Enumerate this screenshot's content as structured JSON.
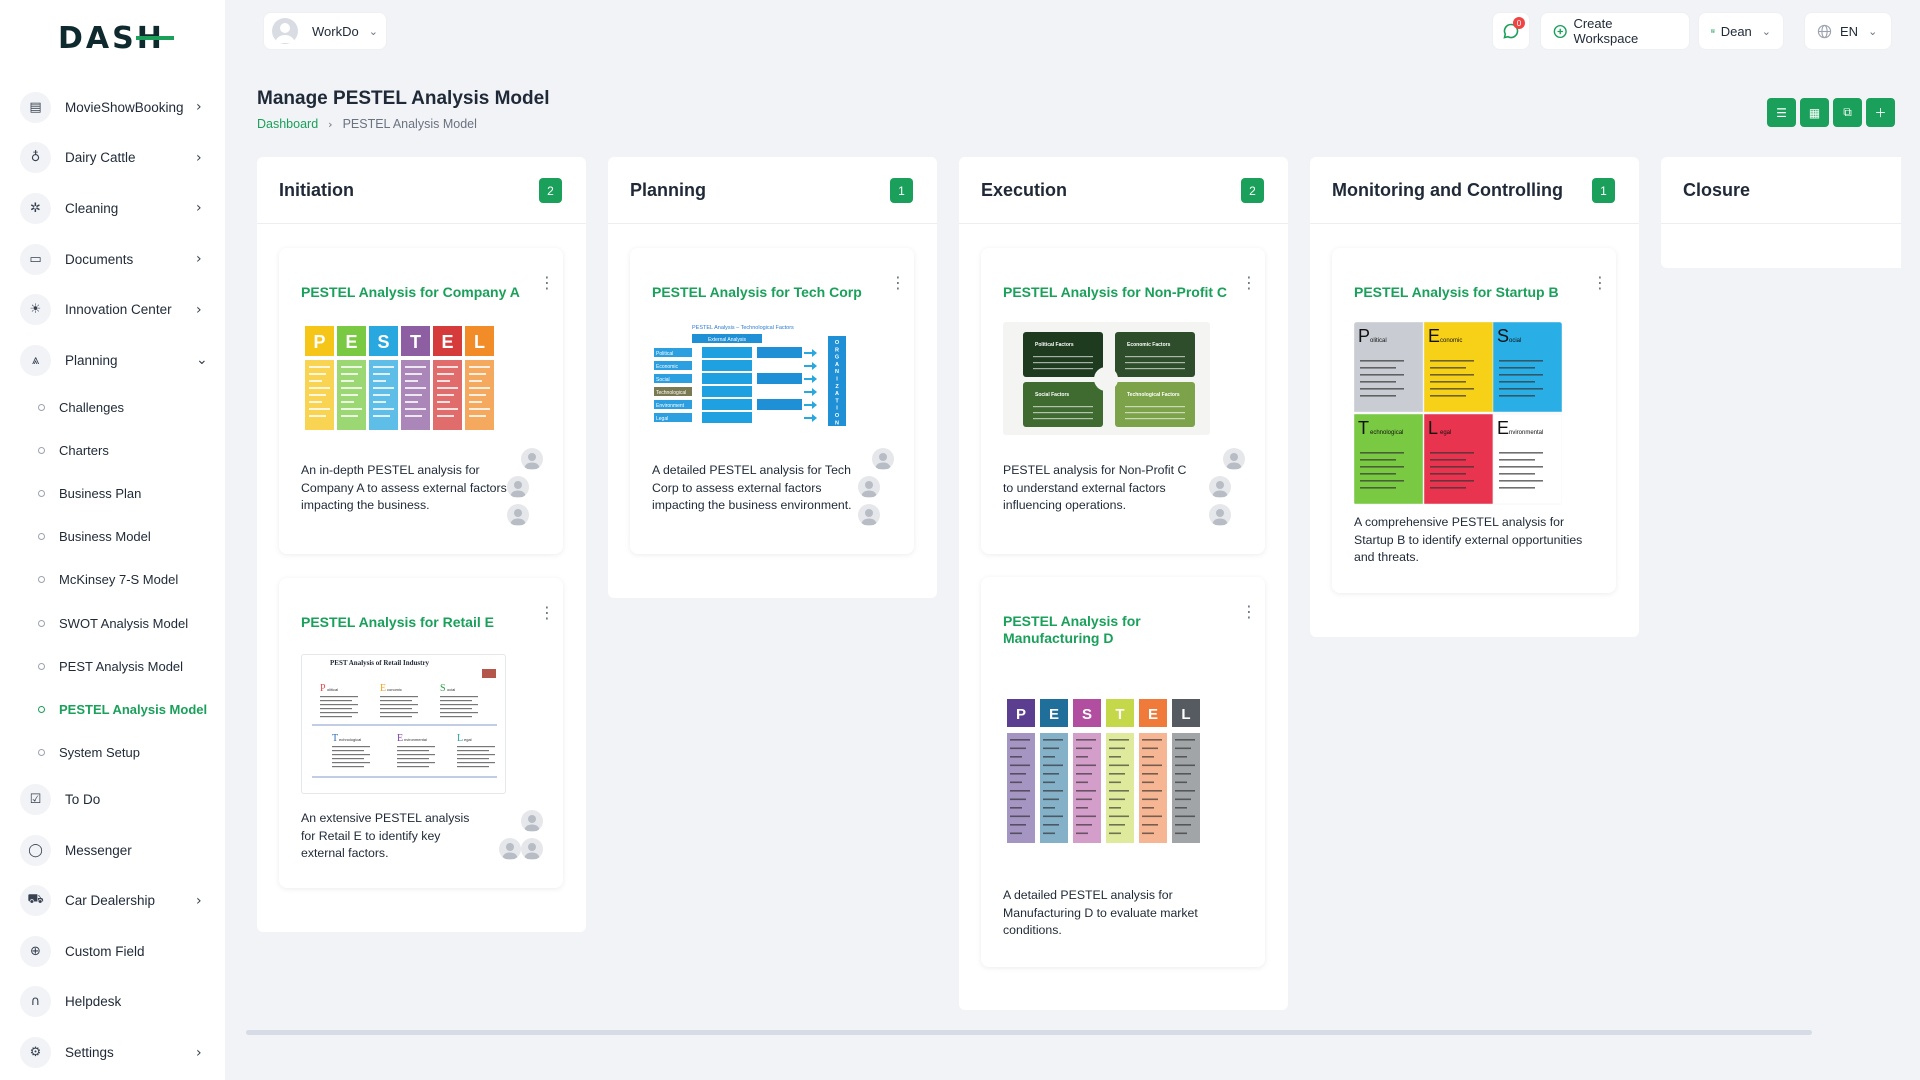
{
  "brand": {
    "logo_text": "DASH",
    "accent": "#1aa05a"
  },
  "sidebar": {
    "items": [
      {
        "label": "MovieShowBooking",
        "icon": "film-icon",
        "chevron": "›"
      },
      {
        "label": "Dairy Cattle",
        "icon": "bottle-icon",
        "chevron": "›"
      },
      {
        "label": "Cleaning",
        "icon": "sparkle-icon",
        "chevron": "›"
      },
      {
        "label": "Documents",
        "icon": "document-icon",
        "chevron": "›"
      },
      {
        "label": "Innovation Center",
        "icon": "bulb-icon",
        "chevron": "›"
      },
      {
        "label": "Planning",
        "icon": "planning-icon",
        "chevron": "⌄"
      }
    ],
    "planning_sub": [
      {
        "label": "Challenges"
      },
      {
        "label": "Charters"
      },
      {
        "label": "Business Plan"
      },
      {
        "label": "Business Model"
      },
      {
        "label": "McKinsey 7-S Model"
      },
      {
        "label": "SWOT Analysis Model"
      },
      {
        "label": "PEST Analysis Model"
      },
      {
        "label": "PESTEL Analysis Model"
      },
      {
        "label": "System Setup"
      }
    ],
    "items_after": [
      {
        "label": "To Do",
        "icon": "checklist-icon",
        "chevron": ""
      },
      {
        "label": "Messenger",
        "icon": "chat-icon",
        "chevron": ""
      },
      {
        "label": "Car Dealership",
        "icon": "car-icon",
        "chevron": "›"
      },
      {
        "label": "Custom Field",
        "icon": "plus-circle-icon",
        "chevron": ""
      },
      {
        "label": "Helpdesk",
        "icon": "headset-icon",
        "chevron": ""
      },
      {
        "label": "Settings",
        "icon": "gear-icon",
        "chevron": "›"
      }
    ]
  },
  "topbar": {
    "workspace": "WorkDo",
    "notification_count": "0",
    "create_workspace": "Create Workspace",
    "user": "Dean",
    "language": "EN"
  },
  "header": {
    "title": "Manage PESTEL Analysis Model",
    "breadcrumb": [
      "Dashboard",
      "PESTEL Analysis Model"
    ]
  },
  "board": {
    "columns": [
      {
        "title": "Initiation",
        "count": "2"
      },
      {
        "title": "Planning",
        "count": "1"
      },
      {
        "title": "Execution",
        "count": "2"
      },
      {
        "title": "Monitoring and Controlling",
        "count": "1"
      },
      {
        "title": "Closure",
        "count": ""
      }
    ],
    "cards": {
      "company_a": {
        "title": "PESTEL Analysis for Company A",
        "desc": "An in-depth PESTEL analysis for Company A to assess external factors impacting the business."
      },
      "retail_e": {
        "title": "PESTEL Analysis for Retail E",
        "desc": "An extensive PESTEL analysis for Retail E to identify key external factors."
      },
      "tech_corp": {
        "title": "PESTEL Analysis for Tech Corp",
        "desc": "A detailed PESTEL analysis for Tech Corp to assess external factors impacting the business environment."
      },
      "non_profit_c": {
        "title": "PESTEL Analysis for Non-Profit C",
        "desc": "PESTEL analysis for Non-Profit C to understand external factors influencing operations."
      },
      "manufacturing_d": {
        "title": "PESTEL Analysis for Manufacturing D",
        "desc": "A detailed PESTEL analysis for Manufacturing D to evaluate market conditions."
      },
      "startup_b": {
        "title": "PESTEL Analysis for Startup B",
        "desc": "A comprehensive PESTEL analysis for Startup B to identify external opportunities and threats."
      }
    },
    "thumb_letters": [
      "P",
      "E",
      "S",
      "T",
      "E",
      "L"
    ],
    "thumb_colors": [
      "#f5c518",
      "#7ac943",
      "#29a8e0",
      "#8e5ea2",
      "#d63b3b",
      "#f28c28"
    ],
    "tech_corp_thumb": {
      "heading": "PESTEL Analysis – Technological Factors",
      "center": "External Analysis",
      "factors": [
        "Political",
        "Economic",
        "Social",
        "Technological",
        "Environment",
        "Legal"
      ],
      "side": "ORGANIZATION"
    },
    "non_profit_thumb": {
      "quadrants": [
        "Political Factors",
        "Economic Factors",
        "Social Factors",
        "Technological Factors"
      ]
    },
    "retail_thumb": {
      "title": "PEST Analysis of Retail Industry",
      "letters": [
        "P",
        "E",
        "S",
        "T",
        "E",
        "L"
      ],
      "words": [
        "olitical",
        "conomic",
        "ocial",
        "echnological",
        "nvironmental",
        "egal"
      ]
    },
    "startup_thumb": {
      "quadrants": [
        {
          "letter": "P",
          "word": "olitical",
          "color": "#c9cdd3"
        },
        {
          "letter": "E",
          "word": "conomic",
          "color": "#f7d117"
        },
        {
          "letter": "S",
          "word": "ocial",
          "color": "#29aee6"
        },
        {
          "letter": "T",
          "word": "echnological",
          "color": "#7ac943"
        },
        {
          "letter": "L",
          "word": "egal",
          "color": "#e8344e"
        },
        {
          "letter": "E",
          "word": "nvironmental",
          "color": "#ffffff"
        }
      ]
    },
    "manufacturing_thumb": {
      "letters": [
        "P",
        "E",
        "S",
        "T",
        "E",
        "L"
      ],
      "colors": [
        "#5b3e8f",
        "#1f6f9a",
        "#b14ea0",
        "#c4d84a",
        "#ef7a3a",
        "#555b60"
      ]
    }
  }
}
